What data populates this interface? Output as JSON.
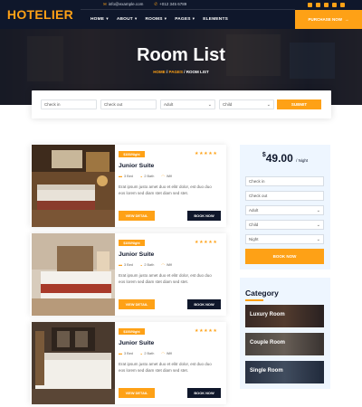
{
  "brand": {
    "logo": "HOTELIER"
  },
  "topbar": {
    "email": "info@example.com",
    "phone": "+012 345 6789"
  },
  "menu": [
    {
      "label": "HOME",
      "caret": true,
      "active": false
    },
    {
      "label": "ABOUT",
      "caret": true,
      "active": false
    },
    {
      "label": "ROOMS",
      "caret": true,
      "active": false
    },
    {
      "label": "PAGES",
      "caret": true,
      "active": false
    },
    {
      "label": "ELEMENTS",
      "caret": false,
      "active": false
    }
  ],
  "purchase_label": "PURCHASE NOW",
  "hero": {
    "title": "Room List",
    "breadcrumb": {
      "home": "HOME",
      "pages": "PAGES",
      "current": "ROOM LIST"
    }
  },
  "booking": {
    "checkin": "Check in",
    "checkout": "Check out",
    "adult": "Adult",
    "child": "Child",
    "submit": "SUBMIT"
  },
  "rooms": [
    {
      "price": "$100/Night",
      "name": "Junior Suite",
      "bed": "3 Bed",
      "bath": "2 Bath",
      "wifi": "Wifi",
      "desc": "Erat ipsum justo amet duo et elitr dolor, est duo duo eos lorem sed diam stet diam sed stet.",
      "details": "VIEW DETAIL",
      "book": "BOOK NOW",
      "rating": 5
    },
    {
      "price": "$100/Night",
      "name": "Junior Suite",
      "bed": "3 Bed",
      "bath": "2 Bath",
      "wifi": "Wifi",
      "desc": "Erat ipsum justo amet duo et elitr dolor, est duo duo eos lorem sed diam stet diam sed stet.",
      "details": "VIEW DETAIL",
      "book": "BOOK NOW",
      "rating": 5
    },
    {
      "price": "$100/Night",
      "name": "Junior Suite",
      "bed": "3 Bed",
      "bath": "2 Bath",
      "wifi": "Wifi",
      "desc": "Erat ipsum justo amet duo et elitr dolor, est duo duo eos lorem sed diam stet diam sed stet.",
      "details": "VIEW DETAIL",
      "book": "BOOK NOW",
      "rating": 5
    }
  ],
  "sidebar": {
    "price": "49.00",
    "currency": "$",
    "per": "/ Night",
    "checkin": "Check in",
    "checkout": "Check out",
    "adult": "Adult",
    "child": "Child",
    "night": "Night",
    "book": "BOOK NOW",
    "category_title": "Category",
    "categories": [
      "Luxury Room",
      "Couple Room",
      "Single Room"
    ]
  },
  "colors": {
    "accent": "#fea116",
    "dark": "#0f172b"
  }
}
